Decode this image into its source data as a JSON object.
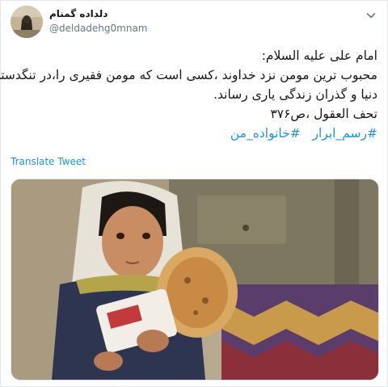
{
  "tweet": {
    "display_name": "دلداده گمنام",
    "handle": "@deldadehg0mnam",
    "text_lines": [
      "امام علی علیه السلام:",
      "محبوب ترین مومن نزد خداوند ،کسی است که مومن فقیری را،در تنگدستی",
      "دنیا و گذران زندگی یاری رساند.",
      "تحف العقول ،ص۳۷۶"
    ],
    "hashtags": [
      "#خانواده_من",
      "#رسم_ابرار"
    ],
    "translate_label": "Translate Tweet"
  },
  "icons": {
    "more": "chevron-down-icon",
    "avatar": "avatar-image",
    "photo": "tweet-photo"
  },
  "colors": {
    "link": "#1b95e0",
    "text": "#14171a",
    "secondary": "#657786",
    "border": "#e1e8ed"
  }
}
